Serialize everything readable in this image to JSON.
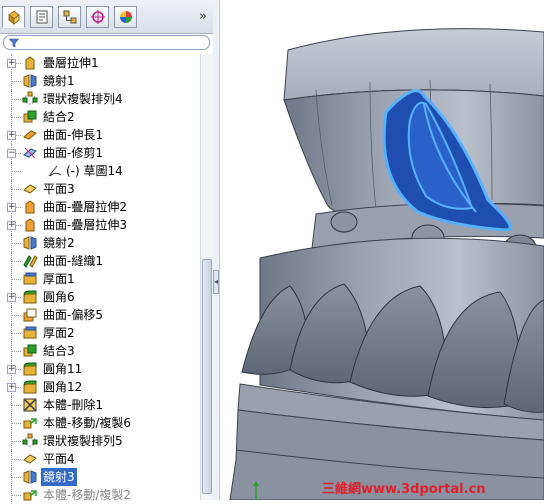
{
  "panel": {
    "tabs": [
      {
        "name": "feature-manager-icon"
      },
      {
        "name": "property-manager-icon"
      },
      {
        "name": "configuration-manager-icon"
      },
      {
        "name": "dimxpert-icon"
      },
      {
        "name": "display-manager-icon"
      }
    ],
    "more_glyph": "»",
    "filter_icon": "filter-icon"
  },
  "tree": [
    {
      "label": "疊層拉伸1",
      "icon": "loft-icon",
      "expand": "+"
    },
    {
      "label": "鏡射1",
      "icon": "mirror-icon",
      "expand": ""
    },
    {
      "label": "環狀複製排列4",
      "icon": "circular-pattern-icon",
      "expand": ""
    },
    {
      "label": "結合2",
      "icon": "combine-icon",
      "expand": ""
    },
    {
      "label": "曲面-伸長1",
      "icon": "surface-extend-icon",
      "expand": "+"
    },
    {
      "label": "曲面-修剪1",
      "icon": "surface-trim-icon",
      "expand": "−"
    },
    {
      "label": "(-) 草圖14",
      "icon": "sketch-icon",
      "expand": "",
      "sub": true
    },
    {
      "label": "平面3",
      "icon": "plane-icon",
      "expand": ""
    },
    {
      "label": "曲面-疊層拉伸2",
      "icon": "surface-loft-icon",
      "expand": "+"
    },
    {
      "label": "曲面-疊層拉伸3",
      "icon": "surface-loft-icon",
      "expand": "+"
    },
    {
      "label": "鏡射2",
      "icon": "mirror-icon",
      "expand": ""
    },
    {
      "label": "曲面-縫織1",
      "icon": "surface-knit-icon",
      "expand": ""
    },
    {
      "label": "厚面1",
      "icon": "thicken-icon",
      "expand": ""
    },
    {
      "label": "圓角6",
      "icon": "fillet-icon",
      "expand": "+"
    },
    {
      "label": "曲面-偏移5",
      "icon": "surface-offset-icon",
      "expand": ""
    },
    {
      "label": "厚面2",
      "icon": "thicken-icon",
      "expand": ""
    },
    {
      "label": "結合3",
      "icon": "combine-icon",
      "expand": ""
    },
    {
      "label": "圓角11",
      "icon": "fillet-icon",
      "expand": "+"
    },
    {
      "label": "圓角12",
      "icon": "fillet-icon",
      "expand": "+"
    },
    {
      "label": "本體-刪除1",
      "icon": "delete-body-icon",
      "expand": ""
    },
    {
      "label": "本體-移動/複製6",
      "icon": "move-copy-body-icon",
      "expand": ""
    },
    {
      "label": "環狀複製排列5",
      "icon": "circular-pattern-icon",
      "expand": ""
    },
    {
      "label": "平面4",
      "icon": "plane-icon",
      "expand": ""
    },
    {
      "label": "鏡射3",
      "icon": "mirror-icon",
      "expand": "",
      "selected": true
    },
    {
      "label": "本體-移動/複製2",
      "icon": "move-copy-body-icon",
      "expand": "",
      "dim": true
    }
  ],
  "colors": {
    "selection": "#3169c6",
    "model_gray": "#8d94a3",
    "highlight_blue": "#1e4fb0",
    "highlight_edge": "#59b0ff"
  },
  "watermark": "三維網www.3dportal.cn"
}
